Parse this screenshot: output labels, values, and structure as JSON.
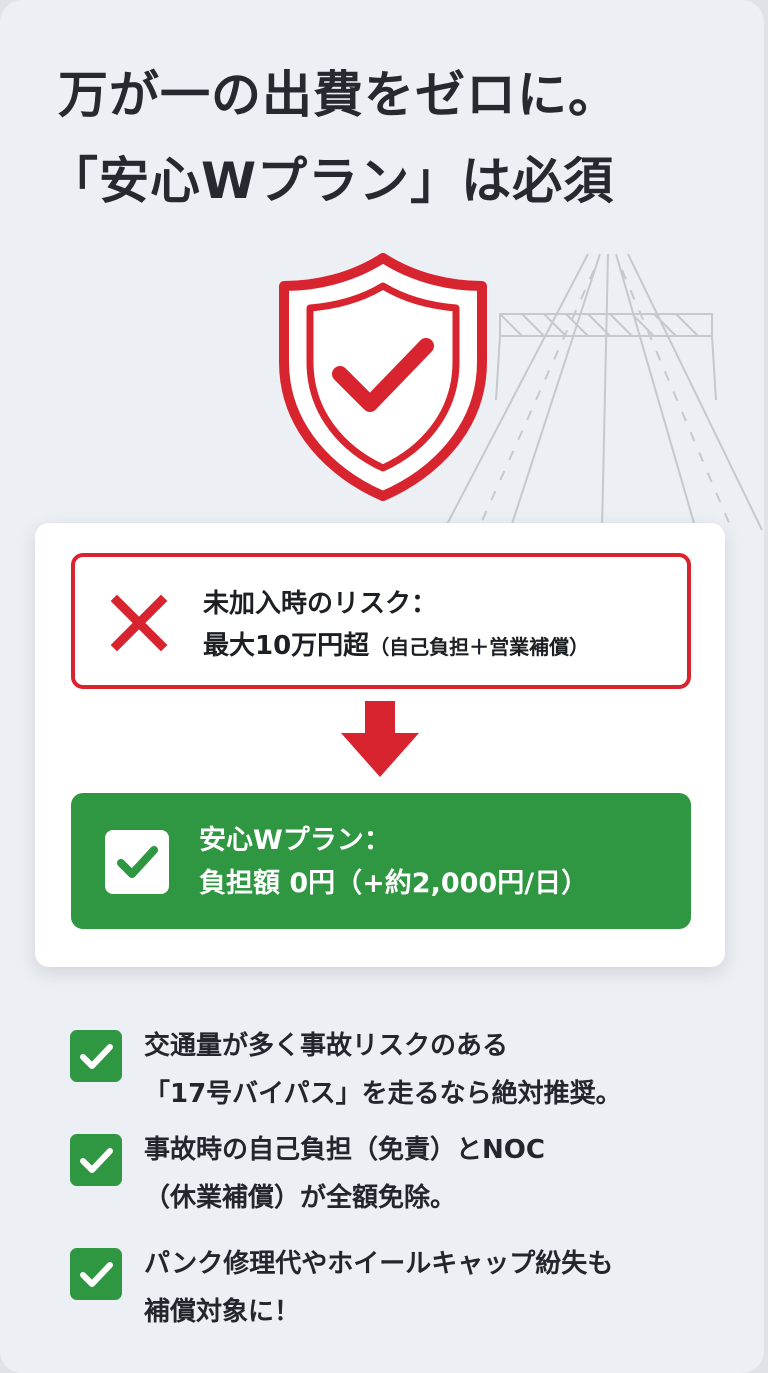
{
  "headline": {
    "line1": "万が一の出費をゼロに。",
    "line2": "「安心Wプラン」は必須"
  },
  "icons": {
    "hero": "shield-check-icon",
    "background": "highway-road-icon",
    "risk": "red-x-icon",
    "arrow": "arrow-down-icon",
    "check": "check-icon"
  },
  "colors": {
    "accent_red": "#d8242f",
    "accent_green": "#2f9641",
    "background": "#eceff3"
  },
  "comparison": {
    "risk": {
      "label": "未加入時のリスク：",
      "amount": "最大10万円超",
      "detail": "（自己負担＋営業補償）"
    },
    "plan": {
      "label": "安心Wプラン：",
      "value": "負担額 0円（+約2,000円/日）"
    }
  },
  "benefits": [
    {
      "line1": "交通量が多く事故リスクのある",
      "line2": "「17号バイパス」を走るなら絶対推奨。"
    },
    {
      "line1": "事故時の自己負担（免責）とNOC",
      "line2": "（休業補償）が全額免除。"
    },
    {
      "line1": "パンク修理代やホイールキャップ紛失も",
      "line2": "補償対象に！"
    }
  ]
}
